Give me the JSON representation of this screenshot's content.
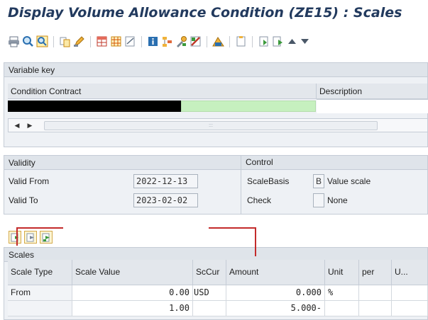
{
  "window": {
    "title": "Display Volume Allowance Condition (ZE15) : Scales"
  },
  "toolbar": {
    "icons": [
      "print-icon",
      "find-icon",
      "find-next-icon",
      "copy-icon",
      "edit-icon",
      "table-icon",
      "grid-icon",
      "note-icon",
      "info-icon",
      "structure-icon",
      "tools-icon",
      "filter-icon",
      "summary-icon",
      "document-icon",
      "import-icon",
      "export-icon",
      "arrow-up-icon",
      "arrow-down-icon"
    ]
  },
  "variable_key": {
    "header": "Variable key",
    "columns": [
      "Condition Contract",
      "Description"
    ],
    "row": {
      "condition_contract": "",
      "description": ""
    },
    "scroll_left": "◀",
    "scroll_right": "▶",
    "scroll_grip": ":::"
  },
  "validity": {
    "header": "Validity",
    "valid_from_label": "Valid From",
    "valid_from": "2022-12-13",
    "valid_to_label": "Valid To",
    "valid_to": "2023-02-02"
  },
  "control": {
    "header": "Control",
    "scale_basis_label": "ScaleBasis",
    "scale_basis_code": "B",
    "scale_basis_text": "Value scale",
    "check_label": "Check",
    "check_code": "",
    "check_text": "None"
  },
  "scales": {
    "header": "Scales",
    "columns": [
      "Scale Type",
      "Scale Value",
      "ScCur",
      "Amount",
      "Unit",
      "per",
      "U..."
    ],
    "rows": [
      {
        "scale_type": "From",
        "scale_value": "0.00",
        "sccur": "USD",
        "amount": "0.000",
        "unit": "%",
        "per": "",
        "u": ""
      },
      {
        "scale_type": "",
        "scale_value": "1.00",
        "sccur": "",
        "amount": "5.000-",
        "unit": "",
        "per": "",
        "u": ""
      }
    ]
  },
  "colors": {
    "title": "#223a5e",
    "panel_bg": "#eef1f5",
    "green_cell": "#c6f0bf",
    "annotation_red": "#c32b2b"
  }
}
